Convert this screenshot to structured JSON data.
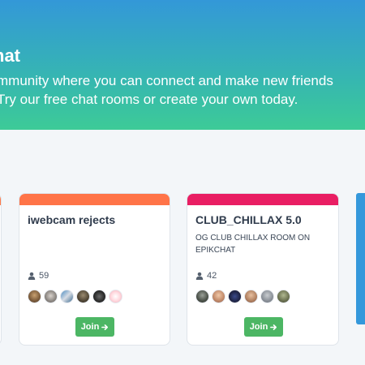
{
  "hero": {
    "title": "hat",
    "line1": "mmunity where you can connect and make new friends",
    "line2": "Try our free chat rooms or create your own today."
  },
  "rooms": [
    {
      "name": "iwebcam rejects",
      "description": "",
      "member_count": "59",
      "accent": "#ff7448",
      "join_label": "Join"
    },
    {
      "name": "CLUB_CHILLAX 5.0",
      "description": "OG CLUB CHILLAX ROOM ON EPIKCHAT",
      "member_count": "42",
      "accent": "#e91e63",
      "join_label": "Join"
    }
  ],
  "colors": {
    "join_button": "#4cb664",
    "background": "#f3f6f9"
  },
  "icons": {
    "members": "user-icon",
    "join": "arrow-right-icon"
  }
}
